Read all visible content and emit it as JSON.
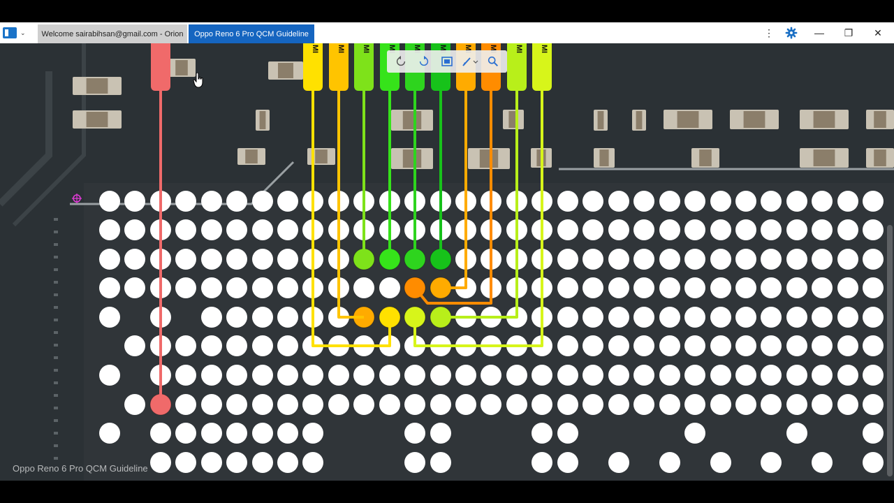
{
  "window": {
    "tabs": [
      {
        "label": "Welcome sairabihsan@gmail.com - Orion"
      },
      {
        "label": "Oppo Reno 6 Pro QCM Guideline"
      }
    ],
    "controls": {
      "kebab": "⋮",
      "minimize": "—",
      "restore": "❐",
      "close": "✕"
    },
    "accent_color": "#1565c0"
  },
  "viewer": {
    "watermark": "Oppo Reno 6 Pro QCM Guideline",
    "tools": [
      "rotate-left-icon",
      "rotate-right-icon",
      "fit-screen-icon",
      "pen-tool-icon",
      "zoom-icon"
    ],
    "pin_label": "MI",
    "trace_colors": [
      "#f06a6a",
      "#ffe100",
      "#ffc400",
      "#7ee21a",
      "#36e31a",
      "#2ed41e",
      "#17c21a",
      "#ffab00",
      "#ff8c00",
      "#b8ef1a",
      "#d7f51a"
    ]
  }
}
